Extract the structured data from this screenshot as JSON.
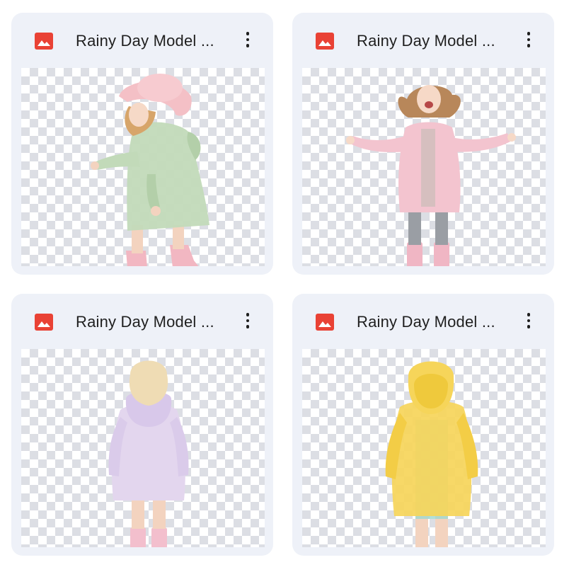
{
  "files": [
    {
      "title": "Rainy Day Model ...",
      "icon": "image-file-icon",
      "coat_color": "#bfd8b8",
      "accent": "#f1c4cc"
    },
    {
      "title": "Rainy Day Model ...",
      "icon": "image-file-icon",
      "coat_color": "#f3c4cf",
      "accent": "#f0b6c4"
    },
    {
      "title": "Rainy Day Model ...",
      "icon": "image-file-icon",
      "coat_color": "#e3d6ee",
      "accent": "#f3bfcd"
    },
    {
      "title": "Rainy Day Model ...",
      "icon": "image-file-icon",
      "coat_color": "#f6d55a",
      "accent": "#9fd8cf"
    }
  ],
  "icons": {
    "more": "more-vert-icon"
  },
  "colors": {
    "card_bg": "#eef1f8",
    "file_icon": "#e94235",
    "text": "#1f1f1f"
  }
}
